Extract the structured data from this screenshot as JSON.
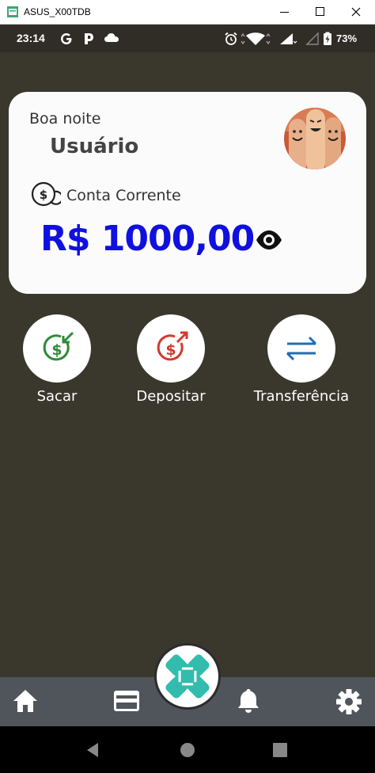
{
  "window": {
    "title": "ASUS_X00TDB"
  },
  "status_bar": {
    "time": "23:14",
    "battery": "73%"
  },
  "card": {
    "greeting": "Boa noite",
    "user_name": "Usuário",
    "account_type": "Conta Corrente",
    "balance": "R$ 1000,00"
  },
  "actions": [
    {
      "label": "Sacar",
      "icon": "withdraw-icon",
      "color": "#2e8b3a"
    },
    {
      "label": "Depositar",
      "icon": "deposit-icon",
      "color": "#d23a2e"
    },
    {
      "label": "Transferência",
      "icon": "transfer-icon",
      "color": "#1f6fb5"
    }
  ],
  "bottom_nav": {
    "items": [
      "home-icon",
      "card-icon",
      "pix-icon",
      "bell-icon",
      "settings-icon"
    ]
  },
  "colors": {
    "background": "#3a372d",
    "balance": "#1010e0",
    "pix": "#32bcad",
    "navbar": "#4f555a"
  }
}
